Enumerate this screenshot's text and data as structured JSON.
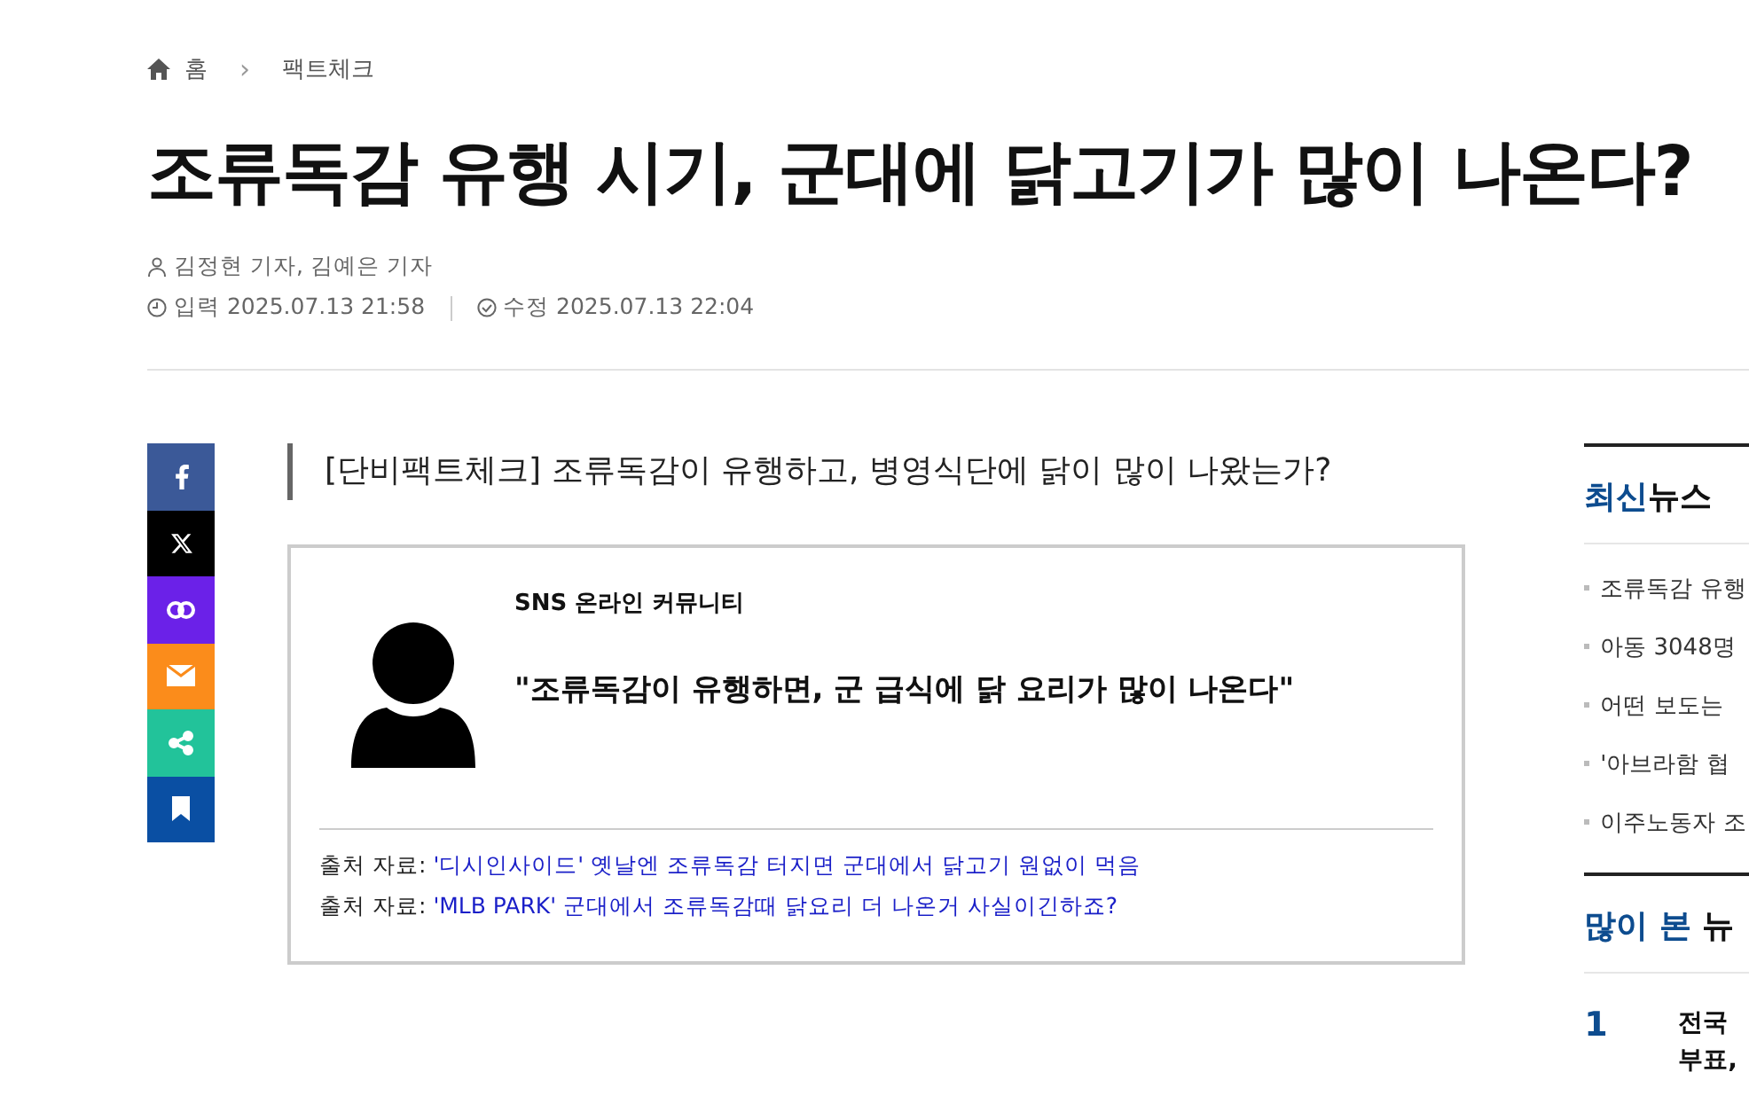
{
  "breadcrumb": {
    "home": "홈",
    "separator": "›",
    "section": "팩트체크"
  },
  "headline": "조류독감 유행 시기, 군대에 닭고기가 많이 나온다?",
  "byline": "김정현 기자, 김예은 기자",
  "published": "입력 2025.07.13 21:58",
  "updated": "수정 2025.07.13 22:04",
  "share_buttons": [
    {
      "kind": "facebook",
      "color": "#3b5998"
    },
    {
      "kind": "x",
      "color": "#000000"
    },
    {
      "kind": "link",
      "color": "#6b21e8"
    },
    {
      "kind": "mail",
      "color": "#fb8c1b"
    },
    {
      "kind": "share",
      "color": "#22c39a"
    },
    {
      "kind": "bookmark",
      "color": "#0a4fa3"
    }
  ],
  "subtitle": "[단비팩트체크] 조류독감이 유행하고, 병영식단에 닭이 많이 나왔는가?",
  "claim": {
    "source": "SNS 온라인 커뮤니티",
    "quote": "\"조류독감이 유행하면, 군 급식에 닭 요리가 많이 나온다\"",
    "references": [
      {
        "label": "출처 자료:",
        "link": "'디시인사이드' 옛날엔 조류독감 터지면 군대에서 닭고기 원없이 먹음"
      },
      {
        "label": "출처 자료:",
        "link": "'MLB PARK' 군대에서 조류독감때 닭요리 더 나온거 사실이긴하죠?"
      }
    ]
  },
  "latest_news": {
    "heading_accent": "최신",
    "heading_rest": "뉴스",
    "items": [
      "조류독감 유행",
      "아동 3048명",
      "어떤 보도는",
      "'아브라함 협",
      "이주노동자 조"
    ]
  },
  "most_viewed": {
    "heading_accent": "많이 본",
    "heading_rest": "뉴",
    "items": [
      {
        "rank": "1",
        "lines": [
          "전국",
          "부표,"
        ]
      }
    ]
  }
}
